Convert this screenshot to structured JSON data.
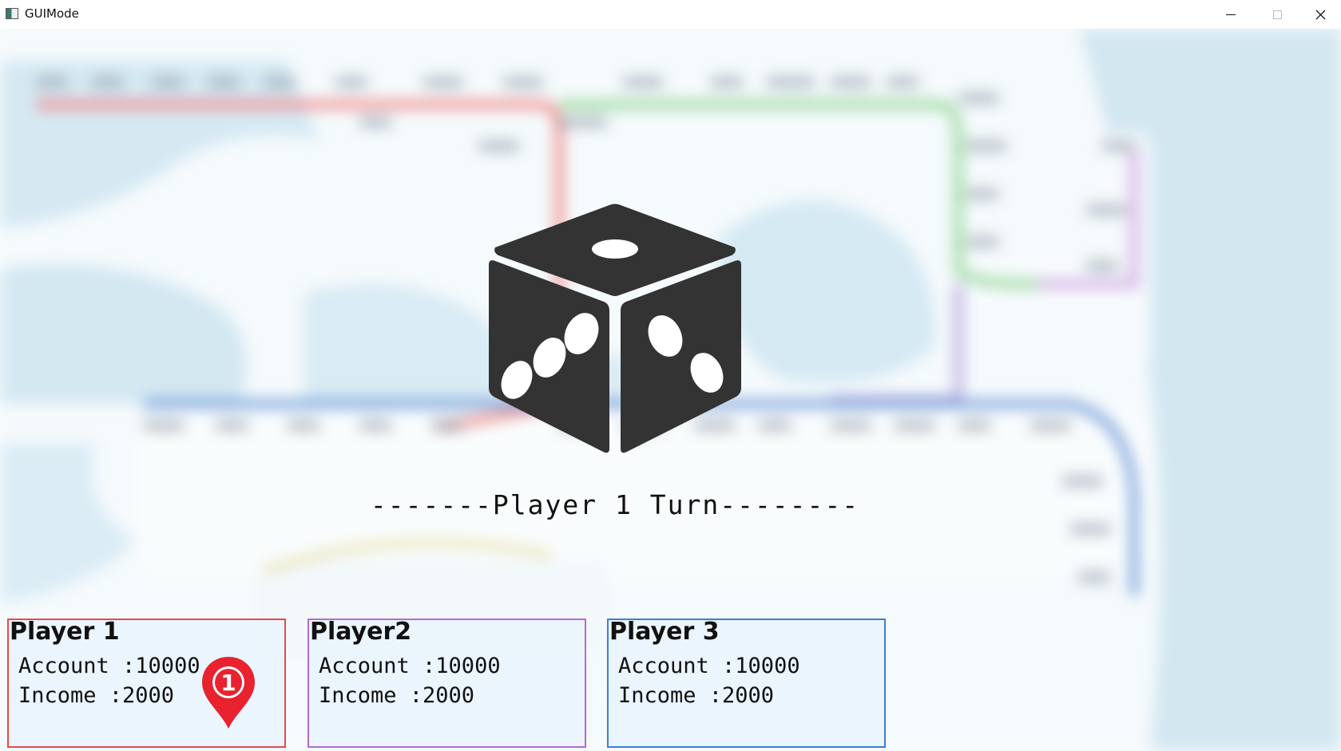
{
  "window": {
    "title": "GUIMode"
  },
  "turn_text": "-------Player 1 Turn--------",
  "players": [
    {
      "name": "Player 1",
      "account": "Account :10000",
      "income": "Income :2000",
      "marker": "1"
    },
    {
      "name": "Player2",
      "account": "Account :10000",
      "income": "Income :2000"
    },
    {
      "name": "Player 3",
      "account": "Account :10000",
      "income": "Income :2000"
    }
  ],
  "colors": {
    "player1": "#e64a4a",
    "player2": "#b36ad6",
    "player3": "#3d7dd8",
    "dice": "#333333",
    "pin": "#e8222e"
  },
  "icons": {
    "window_controls": [
      "minimize-icon",
      "maximize-icon",
      "close-icon"
    ],
    "dice": "dice-icon",
    "player_marker": "map-pin-icon"
  }
}
